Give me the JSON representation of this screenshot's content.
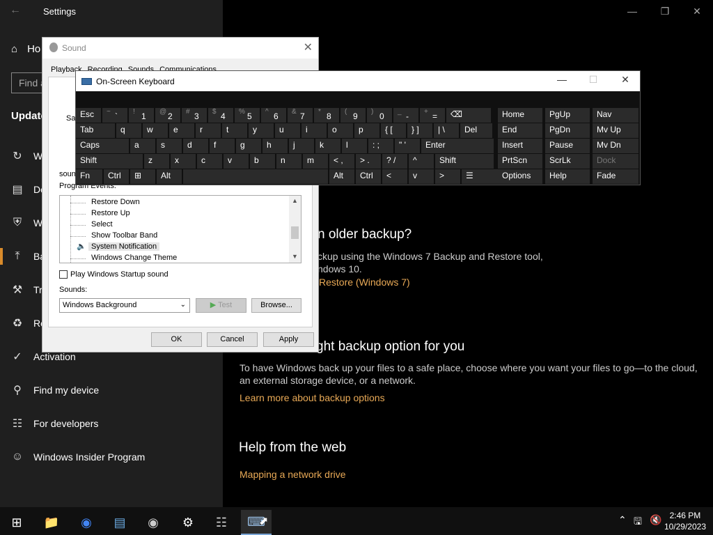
{
  "settings": {
    "title": "Settings",
    "home_label": "Ho",
    "search_placeholder": "Find a",
    "section": "Update",
    "sidebar_items": [
      {
        "label": "W",
        "icon": "refresh-icon"
      },
      {
        "label": "De",
        "icon": "delivery-icon"
      },
      {
        "label": "W",
        "icon": "shield-icon"
      },
      {
        "label": "Ba",
        "icon": "backup-icon"
      },
      {
        "label": "Tr",
        "icon": "wrench-icon"
      },
      {
        "label": "Re",
        "icon": "recovery-icon"
      },
      {
        "label": "Activation",
        "icon": "check-circle-icon"
      },
      {
        "label": "Find my device",
        "icon": "person-location-icon"
      },
      {
        "label": "For developers",
        "icon": "developer-icon"
      },
      {
        "label": "Windows Insider Program",
        "icon": "cat-icon"
      }
    ],
    "content": {
      "older_backup_heading": "n older backup?",
      "older_backup_text1": "ckup using the Windows 7 Backup and Restore tool,",
      "older_backup_text2": "ndows 10.",
      "older_backup_link": "Restore (Windows 7)",
      "right_option_heading": "ght backup option for you",
      "right_option_text1": "To have Windows back up your files to a safe place, choose where you want your files to go—to the cloud,",
      "right_option_text2": "an external storage device, or a network.",
      "right_option_link": "Learn more about backup options",
      "help_heading": "Help from the web",
      "help_link": "Mapping a network drive"
    }
  },
  "sound": {
    "title": "Sound",
    "tabs": [
      "Playback",
      "Recording",
      "Sounds",
      "Communications"
    ],
    "save_label": "Sav",
    "sound_label": "soun",
    "program_events_label": "Program Events:",
    "events": [
      "Restore Down",
      "Restore Up",
      "Select",
      "Show Toolbar Band",
      "System Notification",
      "Windows Change Theme"
    ],
    "selected_event": "System Notification",
    "startup_checkbox": "Play Windows Startup sound",
    "sounds_label": "Sounds:",
    "sounds_value": "Windows Background",
    "test_button": "Test",
    "browse_button": "Browse...",
    "ok": "OK",
    "cancel": "Cancel",
    "apply": "Apply"
  },
  "osk": {
    "title": "On-Screen Keyboard",
    "row1": [
      {
        "label": "Esc"
      },
      {
        "shift": "~",
        "main": "`"
      },
      {
        "shift": "!",
        "main": "1"
      },
      {
        "shift": "@",
        "main": "2"
      },
      {
        "shift": "#",
        "main": "3"
      },
      {
        "shift": "$",
        "main": "4"
      },
      {
        "shift": "%",
        "main": "5"
      },
      {
        "shift": "^",
        "main": "6"
      },
      {
        "shift": "&",
        "main": "7"
      },
      {
        "shift": "*",
        "main": "8"
      },
      {
        "shift": "(",
        "main": "9"
      },
      {
        "shift": ")",
        "main": "0"
      },
      {
        "shift": "_",
        "main": "-"
      },
      {
        "shift": "+",
        "main": "="
      },
      {
        "label": "⌫"
      }
    ],
    "row2": [
      "Tab",
      "q",
      "w",
      "e",
      "r",
      "t",
      "y",
      "u",
      "i",
      "o",
      "p",
      "{ [",
      "} ]",
      "| \\",
      "Del"
    ],
    "row3": [
      "Caps",
      "a",
      "s",
      "d",
      "f",
      "g",
      "h",
      "j",
      "k",
      "l",
      ": ;",
      "\" '",
      "Enter"
    ],
    "row4": [
      "Shift",
      "z",
      "x",
      "c",
      "v",
      "b",
      "n",
      "m",
      "< ,",
      "> .",
      "? /",
      "^",
      "Shift"
    ],
    "row5": [
      "Fn",
      "Ctrl",
      "⊞",
      "Alt",
      "",
      "Alt",
      "Ctrl",
      "<",
      "v",
      ">",
      "☰"
    ],
    "nav": [
      [
        "Home",
        "PgUp",
        "Nav"
      ],
      [
        "End",
        "PgDn",
        "Mv Up"
      ],
      [
        "Insert",
        "Pause",
        "Mv Dn"
      ],
      [
        "PrtScn",
        "ScrLk",
        "Dock"
      ],
      [
        "Options",
        "Help",
        "Fade"
      ]
    ]
  },
  "taskbar": {
    "time": "2:46 PM",
    "date": "10/29/2023",
    "apps": [
      "start-icon",
      "file-explorer-icon",
      "chrome-icon",
      "control-panel-icon",
      "sound-icon",
      "settings-icon",
      "notepad-icon",
      "osk-icon"
    ]
  }
}
